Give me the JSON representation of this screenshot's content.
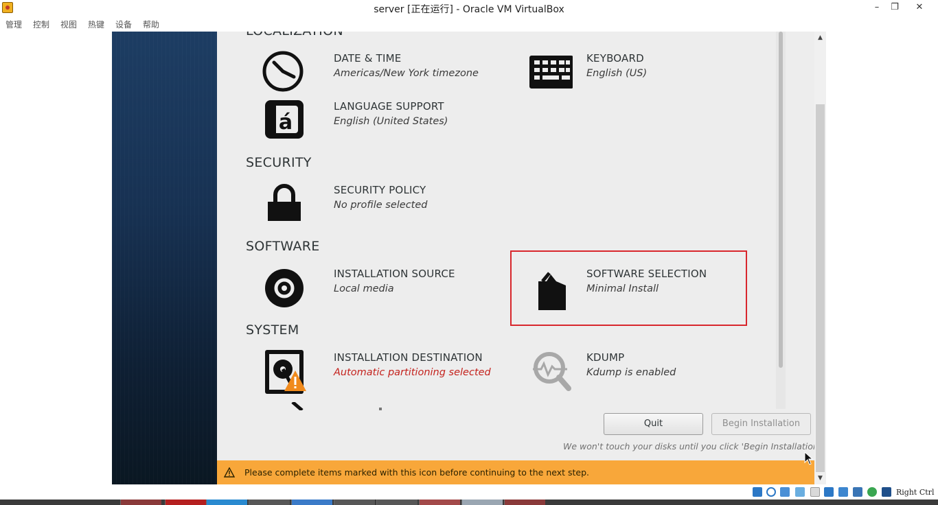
{
  "window": {
    "title": "server [正在运行] - Oracle VM VirtualBox",
    "minimize": "–",
    "restore": "❐",
    "close": "✕"
  },
  "menu": [
    "管理",
    "控制",
    "视图",
    "热键",
    "设备",
    "帮助"
  ],
  "sections": {
    "localization": "LOCALIZATION",
    "security": "SECURITY",
    "software": "SOFTWARE",
    "system": "SYSTEM"
  },
  "spokes": {
    "datetime": {
      "title": "DATE & TIME",
      "status": "Americas/New York timezone",
      "icon": "clock-icon"
    },
    "keyboard": {
      "title": "KEYBOARD",
      "status": "English (US)",
      "icon": "keyboard-icon"
    },
    "language": {
      "title": "LANGUAGE SUPPORT",
      "status": "English (United States)",
      "icon": "language-icon"
    },
    "security_policy": {
      "title": "SECURITY POLICY",
      "status": "No profile selected",
      "icon": "lock-icon"
    },
    "install_source": {
      "title": "INSTALLATION SOURCE",
      "status": "Local media",
      "icon": "disc-icon"
    },
    "software_selection": {
      "title": "SOFTWARE SELECTION",
      "status": "Minimal Install",
      "icon": "package-icon"
    },
    "install_destination": {
      "title": "INSTALLATION DESTINATION",
      "status": "Automatic partitioning selected",
      "icon": "harddisk-icon"
    },
    "kdump": {
      "title": "KDUMP",
      "status": "Kdump is enabled",
      "icon": "kdump-icon"
    }
  },
  "buttons": {
    "quit": "Quit",
    "begin": "Begin Installation"
  },
  "note": "We won't touch your disks until you click 'Begin Installation'.",
  "warning_bar": "Please complete items marked with this icon before continuing to the next step.",
  "statusbar": {
    "host_key": "Right Ctrl"
  },
  "colors": {
    "warning_bar": "#f8a73a",
    "highlight": "#d8262c",
    "warning_text": "#c4221d"
  }
}
